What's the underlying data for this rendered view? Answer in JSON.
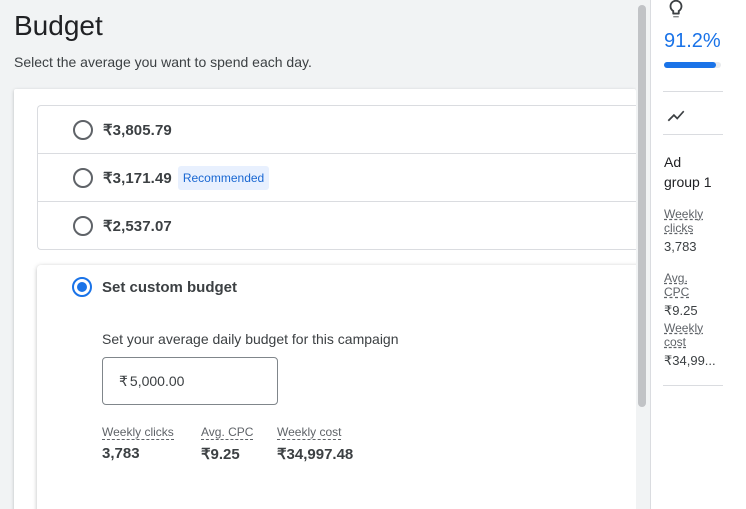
{
  "header": {
    "title": "Budget",
    "subtitle": "Select the average you want to spend each day."
  },
  "options": [
    {
      "amount": "₹3,805.79",
      "badge": "",
      "selected": false
    },
    {
      "amount": "₹3,171.49",
      "badge": "Recommended",
      "selected": false
    },
    {
      "amount": "₹2,537.07",
      "badge": "",
      "selected": false
    }
  ],
  "custom": {
    "title": "Set custom budget",
    "selected": true,
    "description": "Set your average daily budget for this campaign",
    "currency_symbol": "₹",
    "input_value": "5,000.00",
    "stats": [
      {
        "label": "Weekly clicks",
        "value": "3,783"
      },
      {
        "label": "Avg. CPC",
        "value": "₹9.25"
      },
      {
        "label": "Weekly cost",
        "value": "₹34,997.48"
      }
    ]
  },
  "sidebar": {
    "icon_top": "lightbulb-icon",
    "optimization_score": "91.2%",
    "optimization_score_fraction": 0.912,
    "icon_trend": "trending-icon",
    "ad_group_line1": "Ad",
    "ad_group_line2": "group 1",
    "stats": [
      {
        "label_line1": "Weekly",
        "label_line2": "clicks",
        "value": "3,783"
      },
      {
        "label_line1": "Avg. CPC",
        "label_line2": "",
        "value": "₹9.25"
      },
      {
        "label_line1": "Weekly",
        "label_line2": "cost",
        "value": "₹34,99..."
      }
    ]
  },
  "colors": {
    "accent": "#1a73e8",
    "badge_bg": "#e8f0fe"
  }
}
